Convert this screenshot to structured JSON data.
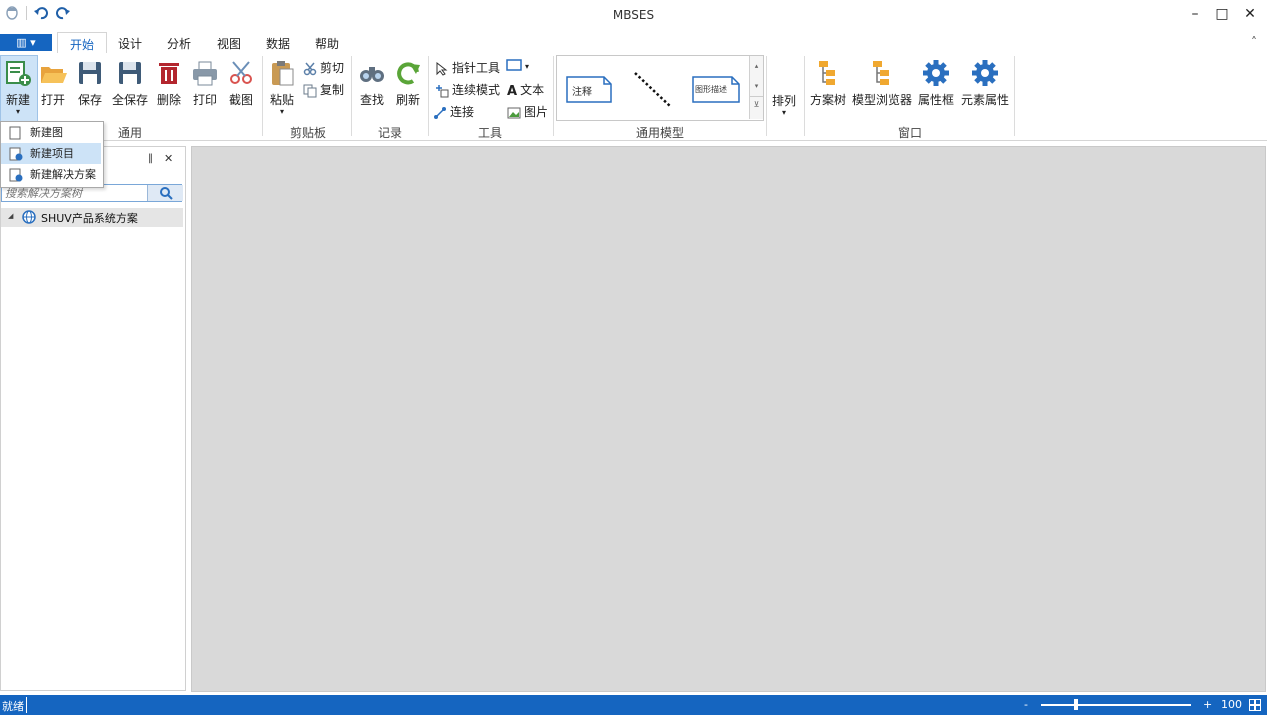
{
  "window": {
    "title": "MBSES",
    "minimize_label": "–",
    "maximize_label": "□",
    "close_label": "✕"
  },
  "menu": {
    "file_label": "▥ ▾",
    "tabs": [
      "开始",
      "设计",
      "分析",
      "视图",
      "数据",
      "帮助"
    ],
    "collapse_label": "˄"
  },
  "ribbon": {
    "general": {
      "new": "新建",
      "open": "打开",
      "save": "保存",
      "save_all": "全保存",
      "delete": "删除",
      "print": "打印",
      "screenshot": "截图",
      "group": "通用"
    },
    "clipboard": {
      "paste": "粘贴",
      "cut": "剪切",
      "copy": "复制",
      "group": "剪贴板"
    },
    "record": {
      "find": "查找",
      "refresh": "刷新",
      "group": "记录"
    },
    "tools": {
      "pointer": "指针工具",
      "continuous": "连续模式",
      "connect": "连接",
      "text": "文本",
      "image": "图片",
      "group": "工具"
    },
    "models": {
      "note": "注释",
      "graphic_desc": "图形描述",
      "group": "通用模型"
    },
    "arrange": {
      "label": "排列"
    },
    "window": {
      "solution_tree": "方案树",
      "model_browser": "模型浏览器",
      "property_box": "属性框",
      "element_property": "元素属性",
      "group": "窗口"
    }
  },
  "new_dropdown": {
    "items": [
      "新建图",
      "新建项目",
      "新建解决方案"
    ]
  },
  "panel": {
    "pin_label": "‖",
    "close_label": "✕",
    "search_placeholder": "搜索解决方案树",
    "tree": {
      "root": "SHUV产品系统方案",
      "expander": "◢"
    }
  },
  "status": {
    "text": "就绪",
    "zoom_minus": "-",
    "zoom_plus": "+",
    "zoom_value": "100"
  },
  "colors": {
    "accent": "#1565c0",
    "canvas": "#d9d9d9",
    "highlight": "#cde3f7"
  }
}
